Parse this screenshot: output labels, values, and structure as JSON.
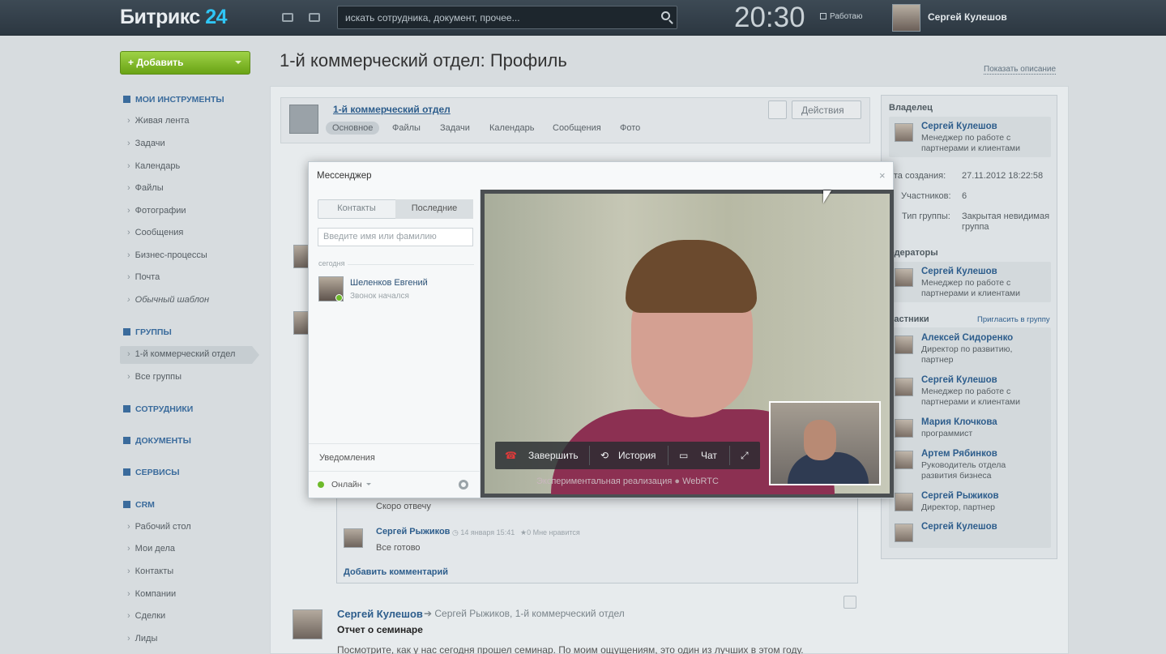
{
  "header": {
    "logo_text": "Битрикс",
    "logo_num": "24",
    "search_placeholder": "искать сотрудника, документ, прочее...",
    "clock": "20:30",
    "work_status": "Работаю",
    "user_name": "Сергей Кулешов"
  },
  "sidebar": {
    "add_button": "Добавить",
    "my_tools": "МОИ ИНСТРУМЕНТЫ",
    "tools": [
      "Живая лента",
      "Задачи",
      "Календарь",
      "Файлы",
      "Фотографии",
      "Сообщения",
      "Бизнес-процессы",
      "Почта",
      "Обычный шаблон"
    ],
    "groups": "ГРУППЫ",
    "group_items": [
      "1-й коммерческий отдел",
      "Все группы"
    ],
    "employees": "СОТРУДНИКИ",
    "documents": "ДОКУМЕНТЫ",
    "services": "СЕРВИСЫ",
    "crm": "CRM",
    "crm_items": [
      "Рабочий стол",
      "Мои дела",
      "Контакты",
      "Компании",
      "Сделки",
      "Лиды"
    ]
  },
  "page": {
    "title": "1-й коммерческий отдел: Профиль",
    "show_description": "Показать описание",
    "group_name": "1-й коммерческий отдел",
    "tabs": [
      "Основное",
      "Файлы",
      "Задачи",
      "Календарь",
      "Сообщения",
      "Фото"
    ],
    "actions": "Действия"
  },
  "feed": {
    "comment_text_1": "Скоро отвечу",
    "comment_author": "Сергей Рыжиков",
    "comment_date": "14 января 15:41",
    "comment_likes": "0 Мне нравится",
    "comment_text_2": "Все готово",
    "add_comment": "Добавить комментарий",
    "post_author": "Сергей Кулешов",
    "post_to": "Сергей Рыжиков, 1-й коммерческий отдел",
    "post_title": "Отчет о семинаре",
    "post_text": "Посмотрите, как у нас сегодня прошел семинар. По моим ощущениям, это один из лучших в этом году."
  },
  "right": {
    "owner_head": "Владелец",
    "owner": {
      "name": "Сергей Кулешов",
      "position": "Менеджер по работе с партнерами и клиентами"
    },
    "created_label": "ата создания:",
    "created_value": "27.11.2012 18:22:58",
    "members_label": "Участников:",
    "members_value": "6",
    "type_label": "Тип группы:",
    "type_value": "Закрытая невидимая группа",
    "moderators_head": "одераторы",
    "moderator": {
      "name": "Сергей Кулешов",
      "position": "Менеджер по работе с партнерами и клиентами"
    },
    "participants_head": "частники",
    "invite": "Пригласить в группу",
    "participants": [
      {
        "name": "Алексей Сидоренко",
        "position": "Директор по развитию, партнер"
      },
      {
        "name": "Сергей Кулешов",
        "position": "Менеджер по работе с партнерами и клиентами"
      },
      {
        "name": "Мария Клочкова",
        "position": "программист"
      },
      {
        "name": "Артем Рябинков",
        "position": "Руководитель отдела развития бизнеса"
      },
      {
        "name": "Сергей Рыжиков",
        "position": "Директор, партнер"
      },
      {
        "name": "Сергей Кулешов",
        "position": ""
      }
    ]
  },
  "messenger": {
    "title": "Мессенджер",
    "close": "×",
    "tab_contacts": "Контакты",
    "tab_recent": "Последние",
    "name_placeholder": "Введите имя или фамилию",
    "today": "сегодня",
    "contact_name": "Шеленков Евгений",
    "contact_status": "Звонок начался",
    "notifications": "Уведомления",
    "online": "Онлайн",
    "end_call": "Завершить",
    "history": "История",
    "chat": "Чат",
    "experimental": "Экспериментальная реализация",
    "webrtc": "WebRTC"
  }
}
